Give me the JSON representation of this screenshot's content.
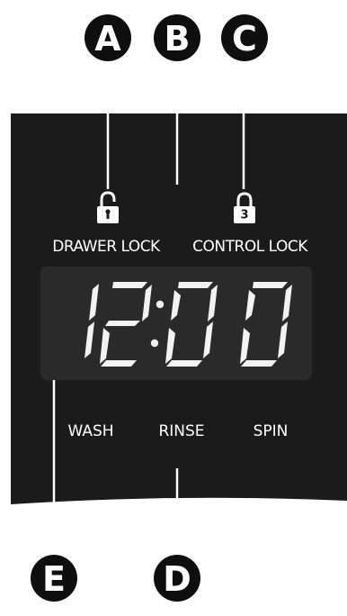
{
  "callouts": {
    "a": "A",
    "b": "B",
    "c": "C",
    "d": "D",
    "e": "E"
  },
  "panel": {
    "drawer_lock_label": "DRAWER LOCK",
    "control_lock_label": "CONTROL LOCK",
    "control_lock_digit": "3",
    "display_time": "12:00",
    "cycle_labels": {
      "wash": "WASH",
      "rinse": "RINSE",
      "spin": "SPIN"
    }
  },
  "colors": {
    "panel": "#1b1b1b",
    "display": "#2a2a2a",
    "segments": "#f2f2f2",
    "callout": "#0f0f0f"
  }
}
